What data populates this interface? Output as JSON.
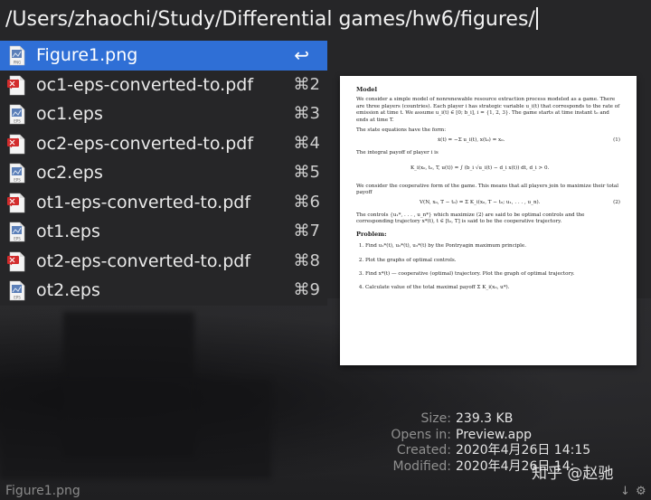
{
  "search": {
    "query": "/Users/zhaochi/Study/Differential games/hw6/figures/"
  },
  "results": [
    {
      "name": "Figure1.png",
      "shortcut": "↩",
      "icon": "png-file-icon"
    },
    {
      "name": "oc1-eps-converted-to.pdf",
      "shortcut": "⌘2",
      "icon": "pdf-file-icon"
    },
    {
      "name": "oc1.eps",
      "shortcut": "⌘3",
      "icon": "eps-file-icon"
    },
    {
      "name": "oc2-eps-converted-to.pdf",
      "shortcut": "⌘4",
      "icon": "pdf-file-icon"
    },
    {
      "name": "oc2.eps",
      "shortcut": "⌘5",
      "icon": "eps-file-icon"
    },
    {
      "name": "ot1-eps-converted-to.pdf",
      "shortcut": "⌘6",
      "icon": "pdf-file-icon"
    },
    {
      "name": "ot1.eps",
      "shortcut": "⌘7",
      "icon": "eps-file-icon"
    },
    {
      "name": "ot2-eps-converted-to.pdf",
      "shortcut": "⌘8",
      "icon": "pdf-file-icon"
    },
    {
      "name": "ot2.eps",
      "shortcut": "⌘9",
      "icon": "eps-file-icon"
    }
  ],
  "preview": {
    "heading": "Model",
    "intro": "We consider a simple model of nonrenewable resource extraction process modeled as a game. There are three players (countries). Each player i has strategic variable u_i(t) that corresponds to the rate of emission at time t. We assume u_i(t) ∈ [0; b_i], i = {1, 2, 3}. The game starts at time instant t₀ and ends at time T.",
    "state_text": "The state equations have the form:",
    "eq1": "ẋ(t) = −Σ u_i(t),   x(t₀) = x₀.",
    "eq1_num": "(1)",
    "payoff_text": "The integral payoff of player i is",
    "eq_payoff": "K_i(x₀, t₀, T, u(t)) = ∫ (b_i √u_i(t) − d_i x(t)) dt,   d_i > 0.",
    "coop_text": "We consider the cooperative form of the game. This means that all players join to maximize their total payoff",
    "eq2": "V(N, x₀, T − t₀) = Σ K_i(x₀, T − t₀; u₁, . . . , u_n).",
    "eq2_num": "(2)",
    "controls_text": "The controls {u₁*, . . . , u_n*} which maximize (2) are said to be optimal controls and the corresponding trajectory x*(t), t ∈ [t₀, T] is said to be the cooperative trajectory.",
    "problem_heading": "Problem:",
    "problems": [
      "Find u₁*(t), u₂*(t), u₃*(t) by the Pontryagin maximum principle.",
      "Plot the graphs of optimal controls.",
      "Find x*(t) — cooperative (optimal) trajectory. Plot the graph of optimal trajectory.",
      "Calculate value of the total maximal payoff Σ K_i(x₀, u*)."
    ]
  },
  "info": {
    "size_label": "Size:",
    "size": "239.3 KB",
    "opens_label": "Opens in:",
    "opens": "Preview.app",
    "created_label": "Created:",
    "created": "2020年4月26日 14:15",
    "modified_label": "Modified:",
    "modified": "2020年4月26日 14:"
  },
  "status": {
    "selected_file": "Figure1.png"
  },
  "watermark": "知乎 @赵驰",
  "colors": {
    "selection": "#2f6fd6",
    "background": "#262628"
  }
}
